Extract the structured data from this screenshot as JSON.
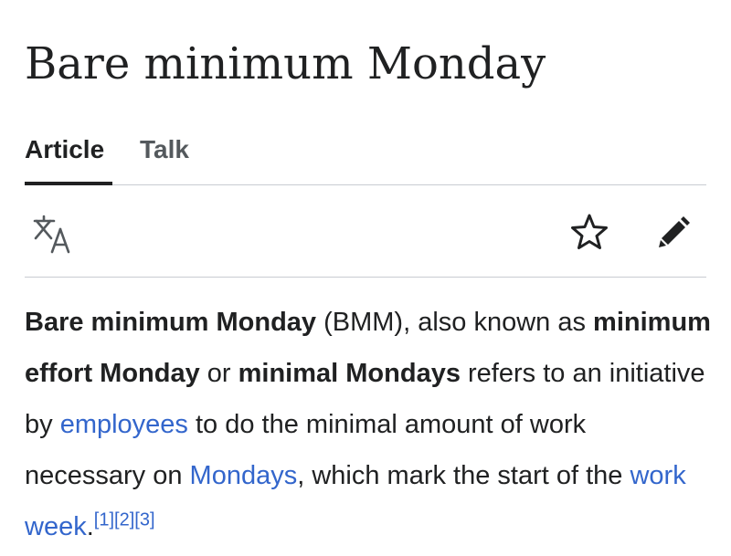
{
  "article": {
    "title": "Bare minimum Monday"
  },
  "tabs": [
    {
      "label": "Article",
      "active": true
    },
    {
      "label": "Talk",
      "active": false
    }
  ],
  "toolbar": {
    "language_icon": "translate-icon",
    "watch_icon": "star-icon",
    "edit_icon": "pencil-icon"
  },
  "body": {
    "term_bmm": "Bare minimum Monday",
    "abbr": " (BMM), also known as ",
    "term_effort": "minimum effort Monday",
    "or": " or ",
    "term_minimal": "minimal Mondays",
    "text1": " refers to an initiative by ",
    "link_employees": "employees",
    "text2": " to do the minimal amount of work necessary on ",
    "link_mondays": "Mondays",
    "text3": ", which mark the start of the ",
    "link_workweek": "work week",
    "period": ".",
    "ref1": "[1]",
    "ref2": "[2]",
    "ref3": "[3]"
  },
  "colors": {
    "text": "#202122",
    "link": "#3366cc",
    "divider": "#c8ccd1",
    "muted": "#54595d",
    "icon": "#54595d"
  }
}
